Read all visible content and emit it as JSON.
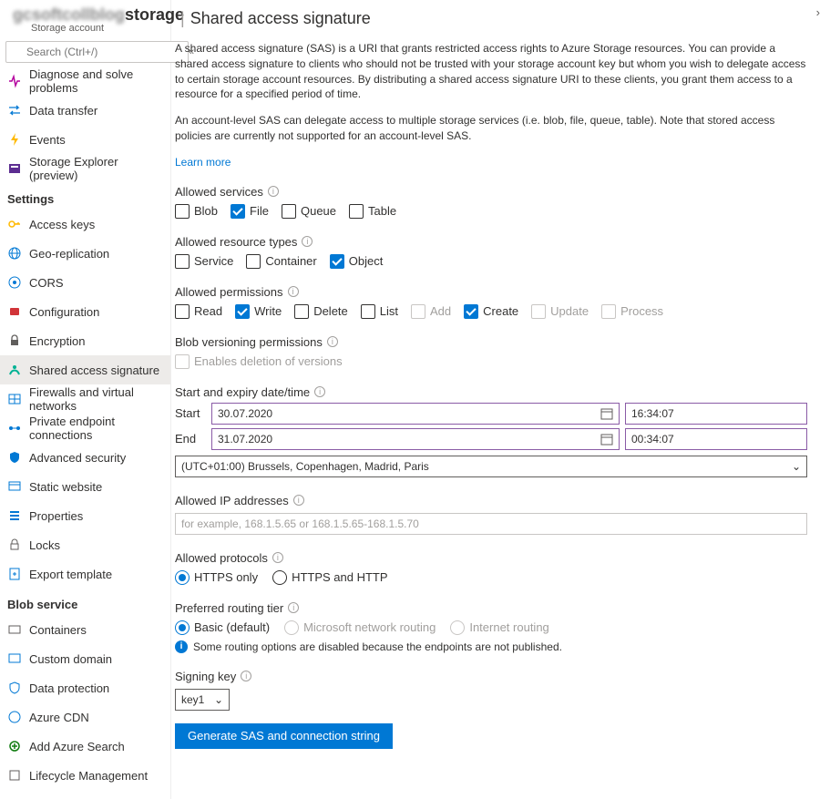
{
  "header": {
    "storage_name": "storage",
    "subtitle": "Storage account",
    "page_title": "Shared access signature"
  },
  "search": {
    "placeholder": "Search (Ctrl+/)"
  },
  "nav_top": [
    {
      "label": "Diagnose and solve problems"
    },
    {
      "label": "Data transfer"
    },
    {
      "label": "Events"
    },
    {
      "label": "Storage Explorer (preview)"
    }
  ],
  "settings_label": "Settings",
  "nav_settings": [
    {
      "label": "Access keys"
    },
    {
      "label": "Geo-replication"
    },
    {
      "label": "CORS"
    },
    {
      "label": "Configuration"
    },
    {
      "label": "Encryption"
    },
    {
      "label": "Shared access signature"
    },
    {
      "label": "Firewalls and virtual networks"
    },
    {
      "label": "Private endpoint connections"
    },
    {
      "label": "Advanced security"
    },
    {
      "label": "Static website"
    },
    {
      "label": "Properties"
    },
    {
      "label": "Locks"
    },
    {
      "label": "Export template"
    }
  ],
  "blob_label": "Blob service",
  "nav_blob": [
    {
      "label": "Containers"
    },
    {
      "label": "Custom domain"
    },
    {
      "label": "Data protection"
    },
    {
      "label": "Azure CDN"
    },
    {
      "label": "Add Azure Search"
    },
    {
      "label": "Lifecycle Management"
    }
  ],
  "desc1": "A shared access signature (SAS) is a URI that grants restricted access rights to Azure Storage resources. You can provide a shared access signature to clients who should not be trusted with your storage account key but whom you wish to delegate access to certain storage account resources. By distributing a shared access signature URI to these clients, you grant them access to a resource for a specified period of time.",
  "desc2": "An account-level SAS can delegate access to multiple storage services (i.e. blob, file, queue, table). Note that stored access policies are currently not supported for an account-level SAS.",
  "learn_more": "Learn more",
  "sec": {
    "services": {
      "label": "Allowed services",
      "opts": [
        "Blob",
        "File",
        "Queue",
        "Table"
      ],
      "checked": [
        false,
        true,
        false,
        false
      ]
    },
    "resource": {
      "label": "Allowed resource types",
      "opts": [
        "Service",
        "Container",
        "Object"
      ],
      "checked": [
        false,
        false,
        true
      ]
    },
    "perms": {
      "label": "Allowed permissions",
      "opts": [
        "Read",
        "Write",
        "Delete",
        "List",
        "Add",
        "Create",
        "Update",
        "Process"
      ],
      "checked": [
        false,
        true,
        false,
        false,
        false,
        true,
        false,
        false
      ],
      "disabled": [
        false,
        false,
        false,
        false,
        true,
        false,
        true,
        true
      ]
    },
    "versioning": {
      "label": "Blob versioning permissions",
      "opt": "Enables deletion of versions"
    },
    "dates": {
      "label": "Start and expiry date/time",
      "start_label": "Start",
      "end_label": "End",
      "start_date": "30.07.2020",
      "start_time": "16:34:07",
      "end_date": "31.07.2020",
      "end_time": "00:34:07",
      "tz": "(UTC+01:00) Brussels, Copenhagen, Madrid, Paris"
    },
    "ip": {
      "label": "Allowed IP addresses",
      "placeholder": "for example, 168.1.5.65 or 168.1.5.65-168.1.5.70"
    },
    "protocols": {
      "label": "Allowed protocols",
      "opts": [
        "HTTPS only",
        "HTTPS and HTTP"
      ]
    },
    "routing": {
      "label": "Preferred routing tier",
      "opts": [
        "Basic (default)",
        "Microsoft network routing",
        "Internet routing"
      ],
      "msg": "Some routing options are disabled because the endpoints are not published."
    },
    "signing": {
      "label": "Signing key",
      "value": "key1"
    }
  },
  "generate": "Generate SAS and connection string"
}
